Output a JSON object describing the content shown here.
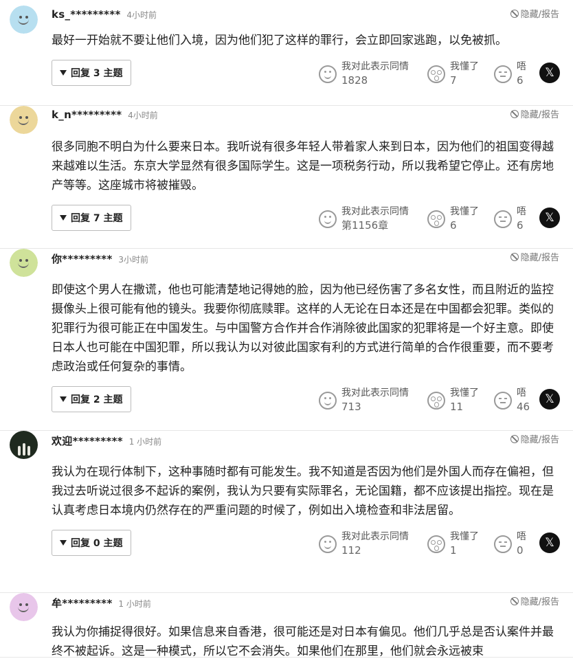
{
  "comments": [
    {
      "user": "ks_*********",
      "time": "4小时前",
      "report": "隐藏/报告",
      "avatar_color": "#b7dff0",
      "text": "最好一开始就不要让他们入境，因为他们犯了这样的罪行，会立即回家逃跑，以免被抓。",
      "reply": "回复 3 主题",
      "sympathy_label": "我对此表示同情",
      "sympathy_count": "1828",
      "understand_label": "我懂了",
      "understand_count": "7",
      "hmm_label": "唔",
      "hmm_count": "6"
    },
    {
      "user": "k_n*********",
      "time": "4小时前",
      "report": "隐藏/报告",
      "avatar_color": "#ecd79a",
      "text": "很多同胞不明白为什么要来日本。我听说有很多年轻人带着家人来到日本，因为他们的祖国变得越来越难以生活。东京大学显然有很多国际学生。这是一项税务行动，所以我希望它停止。还有房地产等等。这座城市将被摧毁。",
      "reply": "回复 7 主题",
      "sympathy_label": "我对此表示同情",
      "sympathy_count": "第1156章",
      "understand_label": "我懂了",
      "understand_count": "6",
      "hmm_label": "唔",
      "hmm_count": "6"
    },
    {
      "user": "你*********",
      "time": "3小时前",
      "report": "隐藏/报告",
      "avatar_color": "#cfe29a",
      "text": "即使这个男人在撒谎，他也可能清楚地记得她的脸，因为他已经伤害了多名女性，而且附近的监控摄像头上很可能有他的镜头。我要你彻底赎罪。这样的人无论在日本还是在中国都会犯罪。类似的犯罪行为很可能正在中国发生。与中国警方合作并合作消除彼此国家的犯罪将是一个好主意。即使日本人也可能在中国犯罪，所以我认为以对彼此国家有利的方式进行简单的合作很重要，而不要考虑政治或任何复杂的事情。",
      "reply": "回复 2 主题",
      "sympathy_label": "我对此表示同情",
      "sympathy_count": "713",
      "understand_label": "我懂了",
      "understand_count": "11",
      "hmm_label": "唔",
      "hmm_count": "46"
    },
    {
      "user": "欢迎*********",
      "time": "1 小时前",
      "report": "隐藏/报告",
      "avatar_color": "photo",
      "text": "我认为在现行体制下，这种事随时都有可能发生。我不知道是否因为他们是外国人而存在偏袒，但我过去听说过很多不起诉的案例，我认为只要有实际罪名，无论国籍，都不应该提出指控。现在是认真考虑日本境内仍然存在的严重问题的时候了，例如出入境检查和非法居留。",
      "reply": "回复 0 主题",
      "sympathy_label": "我对此表示同情",
      "sympathy_count": "112",
      "understand_label": "我懂了",
      "understand_count": "1",
      "hmm_label": "唔",
      "hmm_count": "0"
    },
    {
      "user": "牟*********",
      "time": "1 小时前",
      "report": "隐藏/报告",
      "avatar_color": "#e8c6ea",
      "text": "我认为你捕捉得很好。如果信息来自香港，很可能还是对日本有偏见。他们几乎总是否认案件并最终不被起诉。这是一种模式，所以它不会消失。如果他们在那里，他们就会永远被束"
    }
  ],
  "share_icon": "x-logo"
}
